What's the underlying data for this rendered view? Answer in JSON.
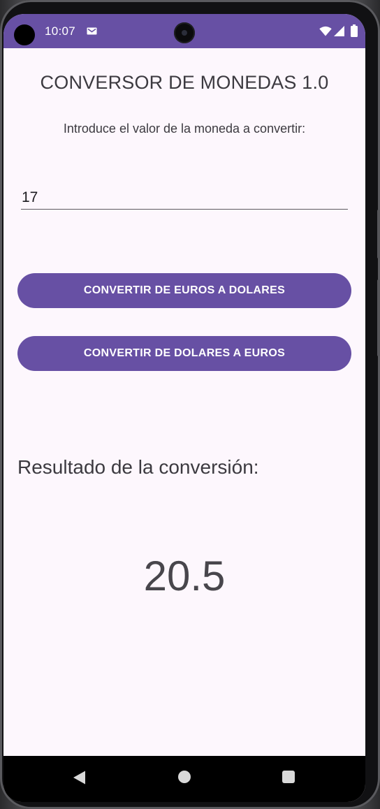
{
  "status_bar": {
    "time": "10:07",
    "notification_icon": "mail-icon",
    "wifi_icon": "wifi-icon",
    "signal_icon": "signal-icon",
    "battery_icon": "battery-icon"
  },
  "app": {
    "title": "CONVERSOR DE MONEDAS 1.0",
    "instruction": "Introduce el valor de la moneda a convertir:",
    "input_value": "17",
    "buttons": {
      "euros_to_dollars": "CONVERTIR DE EUROS A DOLARES",
      "dollars_to_euros": "CONVERTIR DE DOLARES A EUROS"
    },
    "result_label": "Resultado de la conversión:",
    "result_value": "20.5"
  },
  "navigation": {
    "back_icon": "back-triangle-icon",
    "home_icon": "home-circle-icon",
    "recents_icon": "recents-square-icon"
  },
  "colors": {
    "primary": "#6750a4",
    "background": "#fdf7fd",
    "text": "#3c3a40",
    "nav_bar": "#000000"
  }
}
